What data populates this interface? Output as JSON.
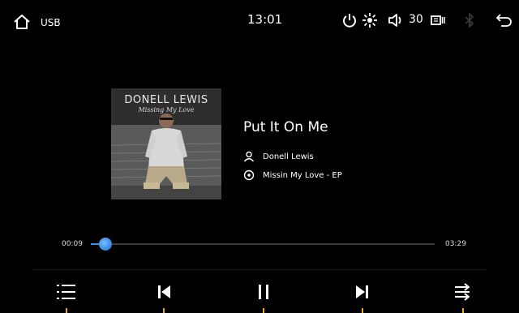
{
  "status_bar": {
    "source_label": "USB",
    "clock": "13:01",
    "volume": "30",
    "icons": [
      "home-icon",
      "power-icon",
      "brightness-icon",
      "volume-icon",
      "display-icon",
      "bluetooth-icon",
      "back-icon"
    ],
    "bluetooth_color": "#3a3a3a"
  },
  "album_art": {
    "artist_text": "DONELL LEWIS",
    "album_text": "Missing My Love"
  },
  "track": {
    "title": "Put It On Me",
    "artist": "Donell Lewis",
    "album": "Missin My Love - EP"
  },
  "progress": {
    "elapsed": "00:09",
    "duration": "03:29",
    "fraction": 0.043,
    "accent": "#3b8ee6"
  },
  "controls": {
    "icons": [
      "playlist-icon",
      "previous-icon",
      "pause-icon",
      "next-icon",
      "repeat-icon"
    ],
    "marker_color": "#e0b020"
  }
}
